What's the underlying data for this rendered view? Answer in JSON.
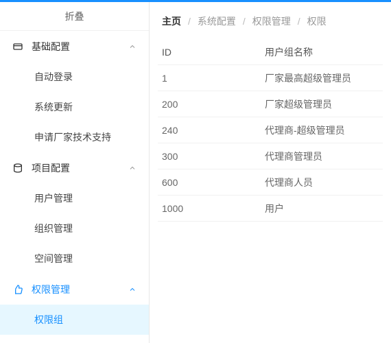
{
  "sidebar": {
    "collapse": "折叠",
    "groups": [
      {
        "label": "基础配置",
        "open": true,
        "icon": "card",
        "items": [
          "自动登录",
          "系统更新",
          "申请厂家技术支持"
        ]
      },
      {
        "label": "项目配置",
        "open": true,
        "icon": "storage",
        "items": [
          "用户管理",
          "组织管理",
          "空间管理"
        ]
      },
      {
        "label": "权限管理",
        "open": true,
        "icon": "thumb",
        "active": true,
        "items": [
          "权限组"
        ],
        "active_item": "权限组"
      }
    ]
  },
  "breadcrumb": [
    "主页",
    "系统配置",
    "权限管理",
    "权限"
  ],
  "table": {
    "columns": [
      "ID",
      "用户组名称"
    ],
    "rows": [
      [
        "1",
        "厂家最高超级管理员"
      ],
      [
        "200",
        "厂家超级管理员"
      ],
      [
        "240",
        "代理商-超级管理员"
      ],
      [
        "300",
        "代理商管理员"
      ],
      [
        "600",
        "代理商人员"
      ],
      [
        "1000",
        "用户"
      ]
    ]
  }
}
